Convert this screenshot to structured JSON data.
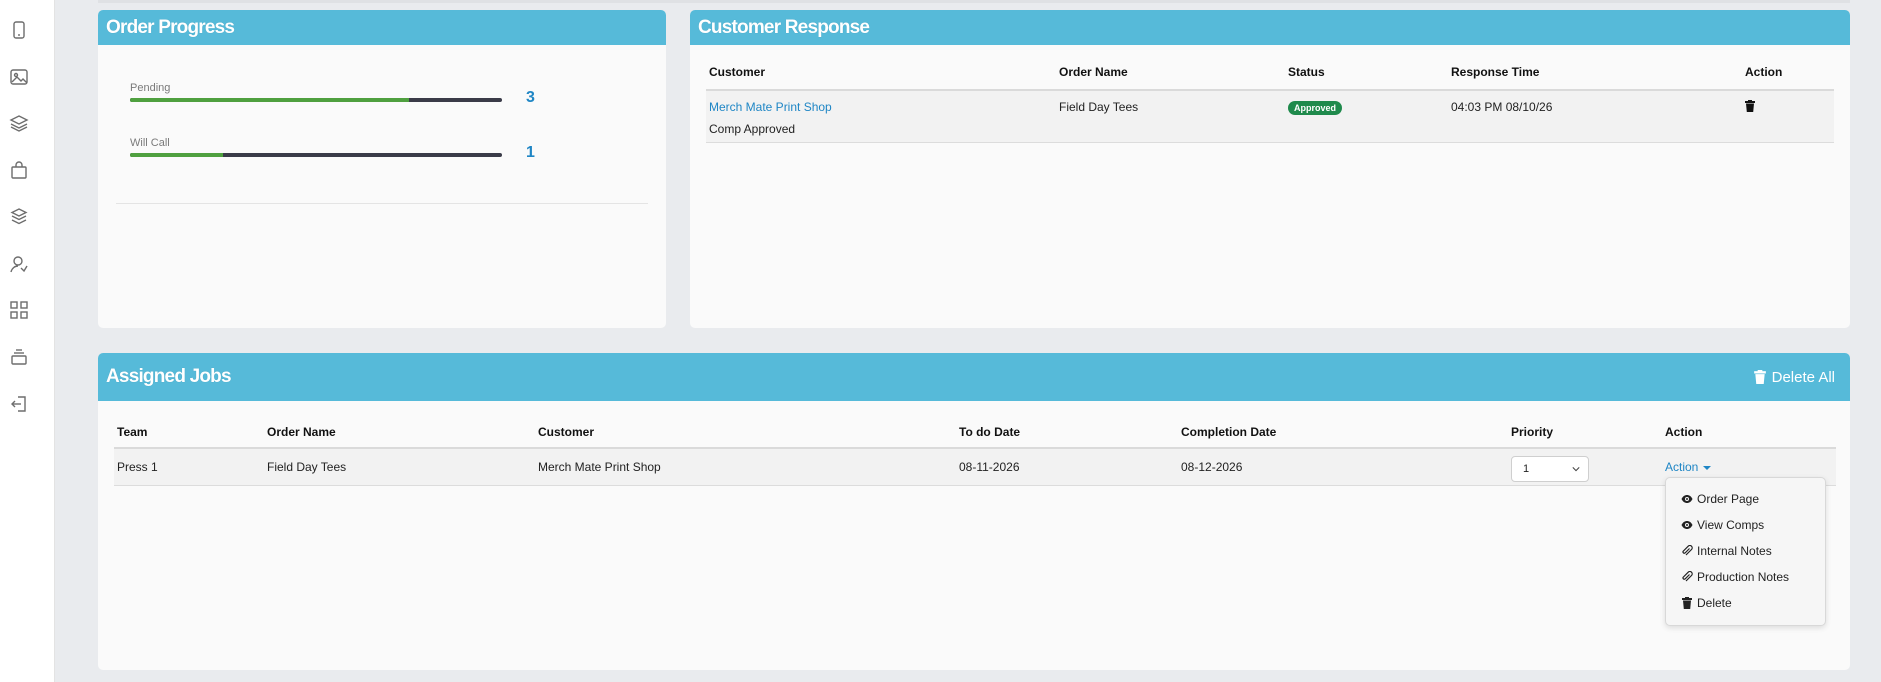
{
  "sidebar": {
    "icons": [
      "tablet-icon",
      "image-icon",
      "layers-icon",
      "shopping-bag-icon",
      "boxes-icon",
      "user-icon",
      "grid-icon",
      "stack-icon",
      "logout-icon"
    ]
  },
  "order_progress": {
    "title": "Order Progress",
    "items": [
      {
        "label": "Pending",
        "count": "3",
        "fill_percent": 75
      },
      {
        "label": "Will Call",
        "count": "1",
        "fill_percent": 25
      }
    ]
  },
  "customer_response": {
    "title": "Customer Response",
    "columns": [
      "Customer",
      "Order Name",
      "Status",
      "Response Time",
      "Action"
    ],
    "rows": [
      {
        "customer": "Merch Mate Print Shop",
        "note": "Comp Approved",
        "order_name": "Field Day Tees",
        "status": "Approved",
        "response_time": "04:03 PM 08/10/26"
      }
    ]
  },
  "assigned_jobs": {
    "title": "Assigned Jobs",
    "delete_all_label": "Delete All",
    "columns": [
      "Team",
      "Order Name",
      "Customer",
      "To do Date",
      "Completion Date",
      "Priority",
      "Action"
    ],
    "rows": [
      {
        "team": "Press 1",
        "order_name": "Field Day Tees",
        "customer": "Merch Mate Print Shop",
        "todo_date": "08-11-2026",
        "completion_date": "08-12-2026",
        "priority": "1",
        "action_label": "Action"
      }
    ],
    "action_menu": [
      {
        "label": "Order Page",
        "icon": "eye-icon"
      },
      {
        "label": "View Comps",
        "icon": "eye-icon"
      },
      {
        "label": "Internal Notes",
        "icon": "paperclip-icon"
      },
      {
        "label": "Production Notes",
        "icon": "paperclip-icon"
      },
      {
        "label": "Delete",
        "icon": "trash-icon"
      }
    ]
  },
  "colors": {
    "header": "#56bad9",
    "progress_fill": "#4fa03f",
    "link": "#1f86c5",
    "approved": "#1f8a4c"
  }
}
